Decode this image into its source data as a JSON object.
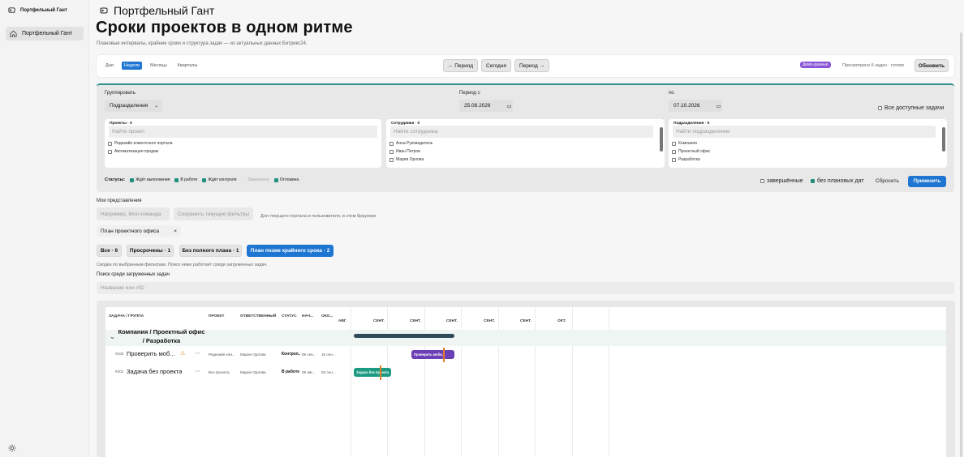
{
  "app": {
    "name": "Портфельный Гант",
    "theme_icon": "sun-icon"
  },
  "sidebar": {
    "items": [
      {
        "label": "Портфельный Гант",
        "icon": "home-icon"
      }
    ]
  },
  "header": {
    "title": "Портфельный Гант",
    "hero": "Сроки проектов в одном ритме",
    "subtitle": "Плановые интервалы, крайние сроки и структура задач — из актуальных данных Битрикс24."
  },
  "toolbar": {
    "tabs": [
      {
        "label": "Дни",
        "active": false
      },
      {
        "label": "Недели",
        "active": true
      },
      {
        "label": "Месяцы",
        "active": false
      },
      {
        "label": "Кварталы",
        "active": false
      }
    ],
    "prev_label": "← Период",
    "today_label": "Сегодня",
    "next_label": "Период →",
    "demo_badge": "Демо-данные",
    "status": "Просмотрено 6 задач · готово",
    "refresh_label": "Обновить"
  },
  "filters": {
    "group_label": "Группировать",
    "group_value": "Подразделения",
    "period_from_label": "Период с",
    "period_from": "25.08.2026",
    "period_to_label": "по",
    "period_to": "07.10.2026",
    "all_tasks_label": "Все доступные задачи",
    "projects": {
      "title": "Проекты · 0",
      "placeholder": "Найти проект",
      "items": [
        "Редизайн клиентского портала",
        "Автоматизация продаж"
      ]
    },
    "employees": {
      "title": "Сотрудники · 0",
      "placeholder": "Найти сотрудника",
      "items": [
        "Анна Руководитель",
        "Иван Петров",
        "Мария Орлова"
      ]
    },
    "departments": {
      "title": "Подразделения · 0",
      "placeholder": "Найти подразделение",
      "items": [
        "Компания",
        "Проектный офис",
        "Разработка"
      ]
    },
    "statuses_label": "Статусы:",
    "statuses": [
      {
        "label": "Ждёт выполнения",
        "checked": true
      },
      {
        "label": "В работе",
        "checked": true
      },
      {
        "label": "Ждёт контроля",
        "checked": true
      },
      {
        "label": "Завершена",
        "checked": false
      },
      {
        "label": "Отложена",
        "checked": true
      }
    ],
    "completed_label": "завершённые",
    "no_plan_label": "без плановых дат",
    "reset_label": "Сбросить",
    "apply_label": "Применить"
  },
  "views": {
    "title": "Мои представления",
    "name_placeholder": "Например, Моя команда",
    "save_label": "Сохранить текущие фильтры",
    "hint": "Для текущего портала и пользователя, в этом браузере",
    "saved": [
      {
        "label": "План проектного офиса"
      }
    ],
    "remove_symbol": "×"
  },
  "quick_filters": {
    "items": [
      {
        "label": "Все · 6",
        "active": false
      },
      {
        "label": "Просрочены · 1",
        "active": false
      },
      {
        "label": "Без полного плана · 1",
        "active": false
      },
      {
        "label": "План позже крайнего срока · 2",
        "active": true
      }
    ],
    "hint": "Сводка по выбранным фильтрам. Поиск ниже работает среди загруженных задач."
  },
  "search": {
    "label": "Поиск среди загруженных задач",
    "placeholder": "Название или #ID"
  },
  "gantt": {
    "columns": [
      "ЗАДАЧА / ГРУППА",
      "ПРОЕКТ",
      "ОТВЕТСТВЕННЫЙ",
      "СТАТУС",
      "НАЧ...",
      "ОКО..."
    ],
    "timeline": [
      "АВГ.",
      "СЕНТ.",
      "СЕНТ.",
      "СЕНТ.",
      "СЕНТ.",
      "СЕНТ.",
      "ОКТ."
    ],
    "group": {
      "title": "Компания / Проектный офис / Разработка",
      "toggle": "⌄",
      "bar_color": "#2f4a5a"
    },
    "rows": [
      {
        "id": "#102",
        "name": "Проверить моб...",
        "warn": "⚠",
        "more": "⋯",
        "project": "Редизайн кли...",
        "owner": "Мария Орлова",
        "status": "Контрол...",
        "start": "06 сен...",
        "end": "15 сен...",
        "bar_label": "Проверить моби...",
        "bar_color": "#6b3fb5"
      },
      {
        "id": "#201",
        "name": "Задача без проекта",
        "warn": "",
        "more": "⋯",
        "project": "Без проекта",
        "owner": "Мария Орлова",
        "status": "В работе",
        "start": "28 авг...",
        "end": "02 сен...",
        "bar_label": "Задача без проекта",
        "bar_color": "#1c9a82"
      }
    ]
  }
}
